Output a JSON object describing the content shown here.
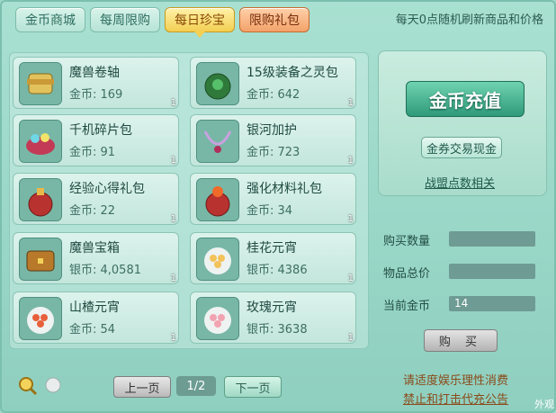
{
  "tabs": [
    {
      "label": "金币商城"
    },
    {
      "label": "每周限购"
    },
    {
      "label": "每日珍宝"
    },
    {
      "label": "限购礼包"
    }
  ],
  "notice": "每天0点随机刷新商品和价格",
  "items": [
    {
      "name": "魔兽卷轴",
      "price": "金币: 169",
      "qty": "1",
      "icon": "scroll-icon"
    },
    {
      "name": "15级装备之灵包",
      "price": "金币: 642",
      "qty": "1",
      "icon": "equipment-bag-icon"
    },
    {
      "name": "千机碎片包",
      "price": "金币: 91",
      "qty": "1",
      "icon": "shard-pack-icon"
    },
    {
      "name": "银河加护",
      "price": "金币: 723",
      "qty": "1",
      "icon": "necklace-icon"
    },
    {
      "name": "经验心得礼包",
      "price": "金币: 22",
      "qty": "1",
      "icon": "gift-bag-icon"
    },
    {
      "name": "强化材料礼包",
      "price": "金币: 34",
      "qty": "1",
      "icon": "material-bag-icon"
    },
    {
      "name": "魔兽宝箱",
      "price": "银币: 4,0581",
      "qty": "1",
      "icon": "treasure-chest-icon"
    },
    {
      "name": "桂花元宵",
      "price": "银币: 4386",
      "qty": "1",
      "icon": "dumpling-bowl-icon"
    },
    {
      "name": "山楂元宵",
      "price": "金币: 54",
      "qty": "1",
      "icon": "dumpling-plate-icon"
    },
    {
      "name": "玫瑰元宵",
      "price": "银币: 3638",
      "qty": "1",
      "icon": "rose-dumpling-icon"
    }
  ],
  "pager": {
    "prev": "上一页",
    "page": "1/2",
    "next": "下一页"
  },
  "right": {
    "recharge": "金币充值",
    "exchange": "金券交易现金",
    "alliance": "战盟点数相关",
    "buy_qty_label": "购买数量",
    "total_label": "物品总价",
    "gold_label": "当前金币",
    "gold_value": "14",
    "buy": "购 买"
  },
  "footer": {
    "line1": "请适度娱乐理性消费",
    "line2": "禁止和打击代充公告",
    "outer": "外观"
  }
}
